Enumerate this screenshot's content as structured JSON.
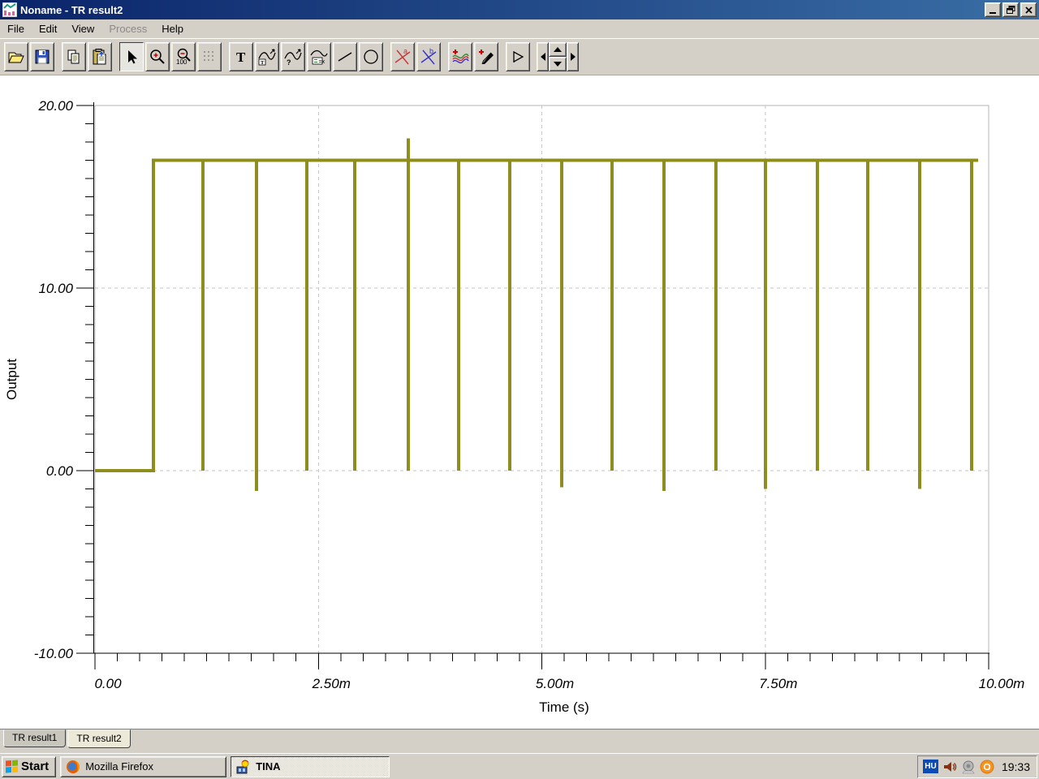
{
  "window": {
    "title": "Noname - TR result2"
  },
  "menu": {
    "items": [
      {
        "label": "File",
        "enabled": true
      },
      {
        "label": "Edit",
        "enabled": true
      },
      {
        "label": "View",
        "enabled": true
      },
      {
        "label": "Process",
        "enabled": false
      },
      {
        "label": "Help",
        "enabled": true
      }
    ]
  },
  "toolbar": {
    "glyphs": {
      "text_tool": "T",
      "zoom_100": "100",
      "cursor_a": "a",
      "cursor_b": "b",
      "curve_query": "?",
      "curve_legend": "=x"
    }
  },
  "chart_data": {
    "type": "line",
    "title": "",
    "xlabel": "Time (s)",
    "ylabel": "Output",
    "xlim_ms": [
      0,
      10
    ],
    "ylim": [
      -10,
      20
    ],
    "x_ticks": [
      {
        "t_ms": 0,
        "label": "0.00"
      },
      {
        "t_ms": 2.5,
        "label": "2.50m"
      },
      {
        "t_ms": 5,
        "label": "5.00m"
      },
      {
        "t_ms": 7.5,
        "label": "7.50m"
      },
      {
        "t_ms": 10,
        "label": "10.00m"
      }
    ],
    "y_ticks": [
      {
        "v": 20,
        "label": "20.00"
      },
      {
        "v": 10,
        "label": "10.00"
      },
      {
        "v": 0,
        "label": "0.00"
      },
      {
        "v": -10,
        "label": "-10.00"
      }
    ],
    "x_minor_step_ms": 0.25,
    "y_minor_step": 1,
    "grid_x_ms": [
      2.5,
      5,
      7.5
    ],
    "grid_y": [
      10,
      0
    ],
    "grid_style": "dashed",
    "series": [
      {
        "name": "Output",
        "color": "#8e8e1e",
        "start_level": 0,
        "high_level": 17,
        "rise_ms": 0.654,
        "end_ms": 9.88,
        "dips": [
          {
            "t_ms": 1.208,
            "min": 0
          },
          {
            "t_ms": 1.807,
            "min": -1.1
          },
          {
            "t_ms": 2.371,
            "min": 0
          },
          {
            "t_ms": 2.906,
            "min": 0
          },
          {
            "t_ms": 3.506,
            "min": 0,
            "overshoot": 18.2
          },
          {
            "t_ms": 4.069,
            "min": 0
          },
          {
            "t_ms": 4.641,
            "min": 0
          },
          {
            "t_ms": 5.223,
            "min": -0.9
          },
          {
            "t_ms": 5.786,
            "min": 0
          },
          {
            "t_ms": 6.367,
            "min": -1.1
          },
          {
            "t_ms": 6.948,
            "min": 0
          },
          {
            "t_ms": 7.502,
            "min": -1.0
          },
          {
            "t_ms": 8.084,
            "min": 0
          },
          {
            "t_ms": 8.647,
            "min": 0
          },
          {
            "t_ms": 9.228,
            "min": -1.0
          },
          {
            "t_ms": 9.809,
            "min": 0
          }
        ]
      }
    ]
  },
  "tabs": [
    {
      "label": "TR result1",
      "active": false
    },
    {
      "label": "TR result2",
      "active": true
    }
  ],
  "taskbar": {
    "start_label": "Start",
    "tasks": [
      {
        "label": "Mozilla Firefox",
        "active": false
      },
      {
        "label": "TINA",
        "active": true
      }
    ],
    "tray": {
      "language_indicator": "HU",
      "clock": "19:33"
    }
  },
  "colors": {
    "titlebar_left": "#0a246a",
    "titlebar_right": "#3a6ea5",
    "chrome": "#d4d0c8",
    "waveform": "#8e8e1e",
    "grid": "#c6c6c6",
    "tray_language_bg": "#0b4bb5"
  }
}
